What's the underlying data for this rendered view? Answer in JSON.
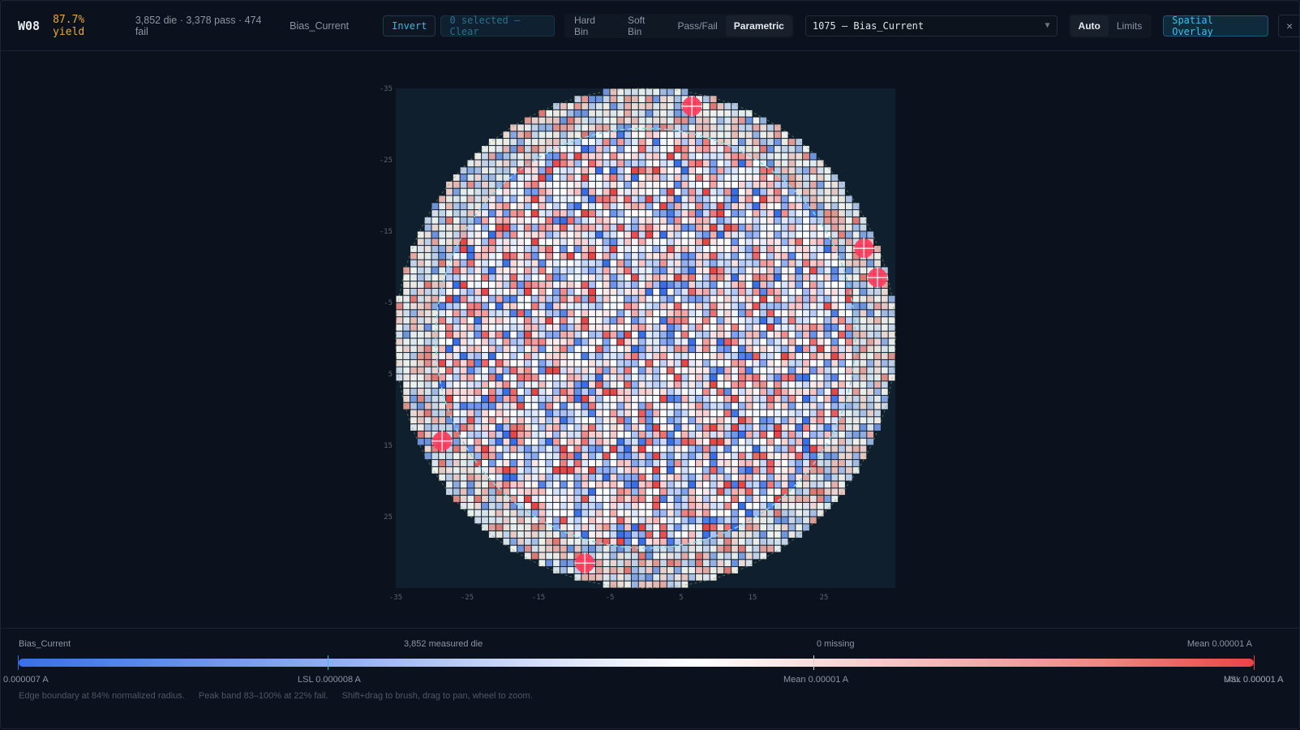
{
  "header": {
    "logo": "W08",
    "yield": "87.7% yield",
    "stats": "3,852 die · 3,378 pass · 474 fail",
    "parameter": "Bias_Current",
    "invert_label": "Invert",
    "selection_label": "0 selected — Clear",
    "view_modes": [
      "Hard Bin",
      "Soft Bin",
      "Pass/Fail",
      "Parametric"
    ],
    "active_view_mode": "Parametric",
    "parameter_select": "1075 — Bias_Current",
    "scale_modes": [
      "Auto",
      "Limits"
    ],
    "active_scale_mode": "Auto",
    "overlay_label": "Spatial Overlay",
    "close_label": "×"
  },
  "chart_data": {
    "type": "heatmap",
    "title": "Wafer map — Bias_Current",
    "x_ticks": [
      "-35",
      "-25",
      "-15",
      "-5",
      "5",
      "15",
      "25"
    ],
    "y_ticks": [
      "-35",
      "-25",
      "-15",
      "-5",
      "5",
      "15",
      "25"
    ],
    "xlim": [
      -35,
      35
    ],
    "ylim": [
      -35,
      35
    ],
    "wafer_radius": 35,
    "edge_boundary_fraction": 0.84,
    "die_count": 3852,
    "fail_markers": [
      [
        6.5,
        -32.5
      ],
      [
        30.6,
        -12.6
      ],
      [
        32.5,
        -8.5
      ],
      [
        -28.5,
        14.4
      ],
      [
        -8.5,
        31.5
      ]
    ],
    "colors": {
      "low": "#3a6ee8",
      "mid": "#ffffff",
      "high": "#e84545",
      "edge_ring": "#7fd4e8",
      "marker": "#ff3b5c"
    }
  },
  "legend": {
    "parameter": "Bias_Current",
    "measured": "3,852 measured die",
    "missing": "0 missing",
    "mean_top": "Mean 0.00001 A",
    "min_label": "0.000007 A",
    "lsl_label": "LSL 0.000008 A",
    "mean_label": "Mean 0.00001 A",
    "max_label": "Max 0.00001 A",
    "usl_label": "USL 0.00001 A"
  },
  "footer": {
    "edge": "Edge boundary at 84% normalized radius.",
    "peak": "Peak band 83–100% at 22% fail.",
    "hint": "Shift+drag to brush, drag to pan, wheel to zoom."
  }
}
